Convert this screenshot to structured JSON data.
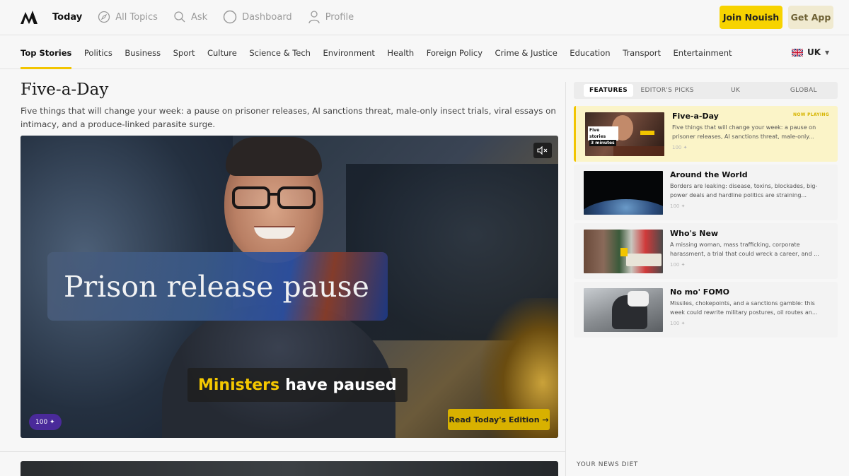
{
  "header": {
    "nav": [
      {
        "label": "Today",
        "icon": "none"
      },
      {
        "label": "All Topics",
        "icon": "compass-icon"
      },
      {
        "label": "Ask",
        "icon": "search-icon"
      },
      {
        "label": "Dashboard",
        "icon": "circle-icon"
      },
      {
        "label": "Profile",
        "icon": "user-icon"
      }
    ],
    "join_label": "Join Nouish",
    "app_label": "Get App"
  },
  "categories": [
    "Top Stories",
    "Politics",
    "Business",
    "Sport",
    "Culture",
    "Science & Tech",
    "Environment",
    "Health",
    "Foreign Policy",
    "Crime & Justice",
    "Education",
    "Transport",
    "Entertainment"
  ],
  "region": {
    "label": "UK"
  },
  "main": {
    "title": "Five-a-Day",
    "description": "Five things that will change your week: a pause on prisoner releases, AI sanctions threat, male-only insect trials, viral essays on intimacy, and a produce-linked parasite surge.",
    "hero": {
      "caption": "Prison release pause",
      "subtitle_highlight": "Ministers",
      "subtitle_rest": "have paused",
      "badge": "100 ✦",
      "cta": "Read Today's Edition →"
    }
  },
  "sidebar": {
    "tabs": [
      "FEATURES",
      "EDITOR'S PICKS",
      "UK",
      "GLOBAL"
    ],
    "items": [
      {
        "title": "Five-a-Day",
        "desc": "Five things that will change your week: a pause on prisoner releases, AI sanctions threat, male-only...",
        "stat": "100 ✦",
        "status": "NOW PLAYING",
        "thumb_text_1": "Five stories",
        "thumb_text_2": "3 minutes"
      },
      {
        "title": "Around the World",
        "desc": "Borders are leaking: disease, toxins, blockades, big-power deals and hardline politics are straining...",
        "stat": "100 ✦"
      },
      {
        "title": "Who's New",
        "desc": "A missing woman, mass trafficking, corporate harassment, a trial that could wreck a career, and ...",
        "stat": "100 ✦"
      },
      {
        "title": "No mo' FOMO",
        "desc": "Missiles, chokepoints, and a sanctions gamble: this week could rewrite military postures, oil routes an...",
        "stat": "100 ✦"
      }
    ],
    "diet_label": "YOUR NEWS DIET"
  },
  "colors": {
    "accent": "#f7d300",
    "badge": "#4a2a9a"
  }
}
